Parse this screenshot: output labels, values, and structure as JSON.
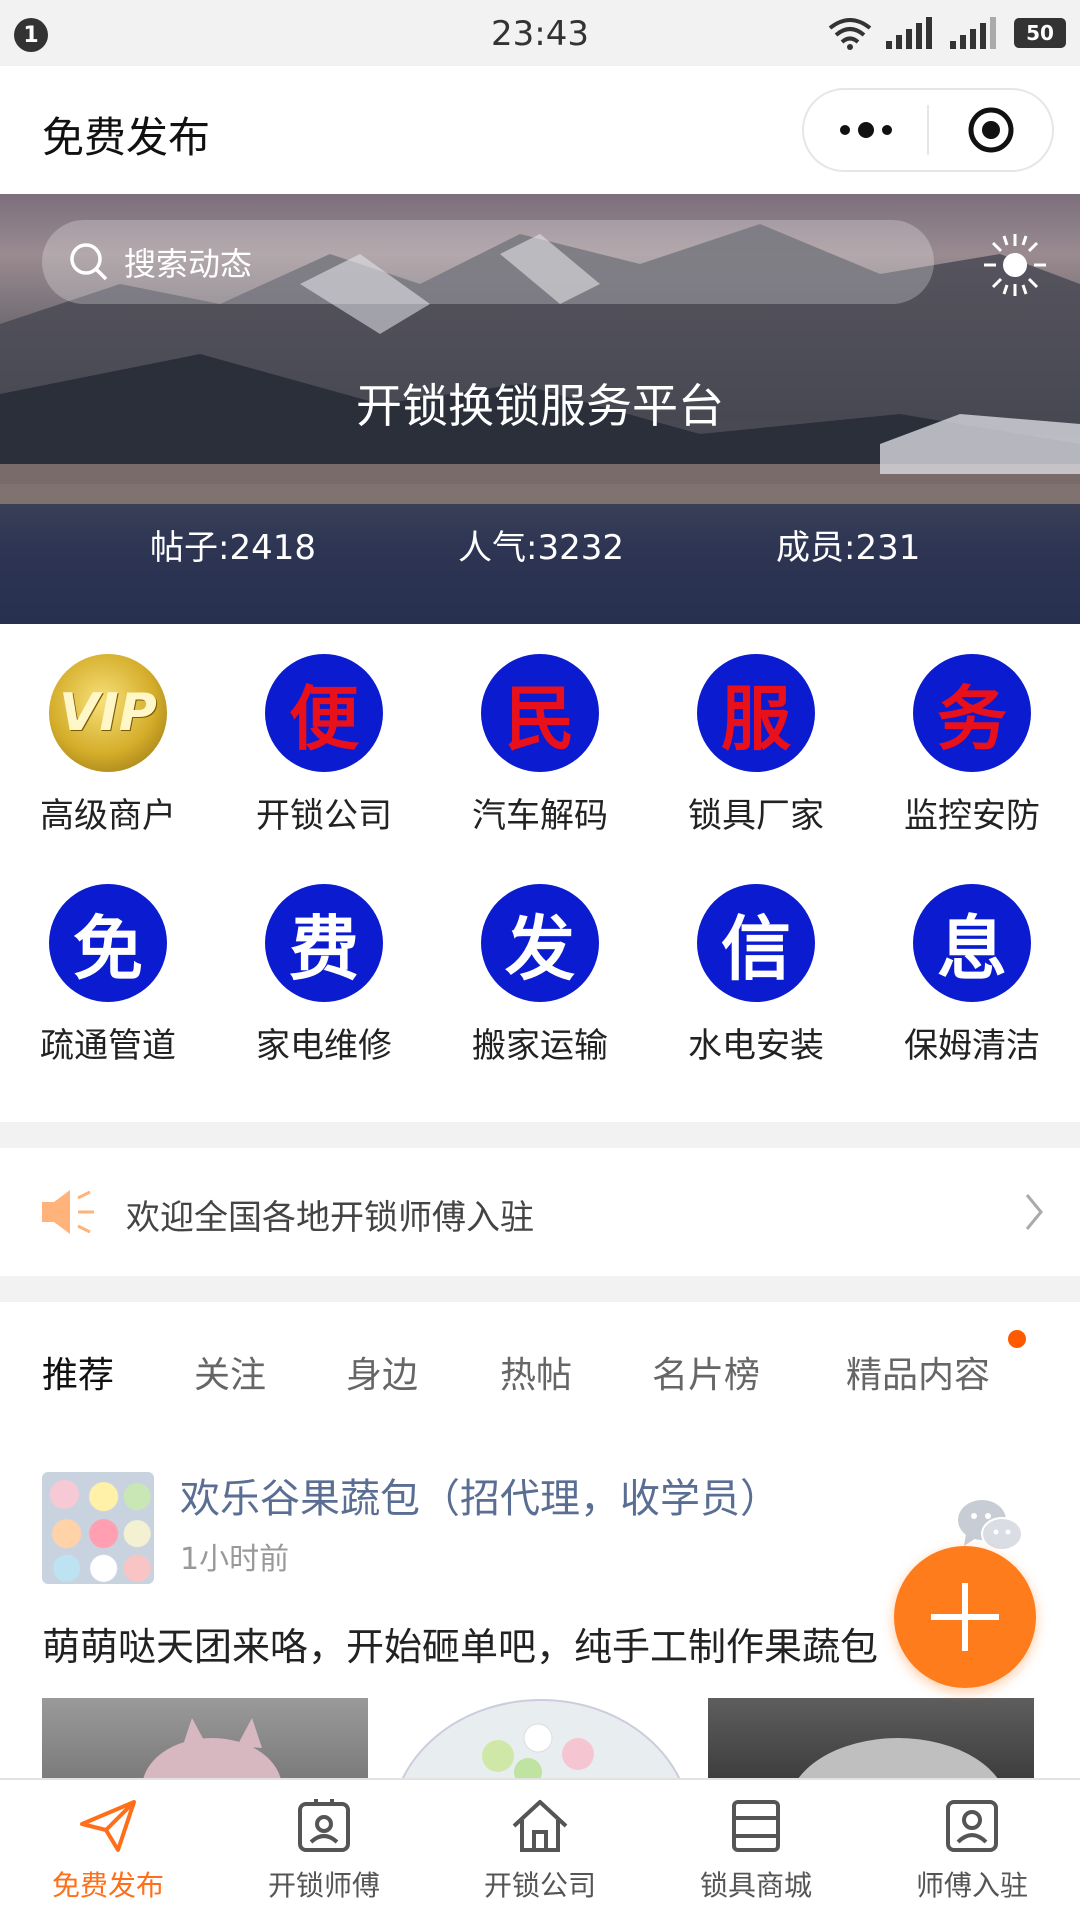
{
  "status_bar": {
    "notification_count": "1",
    "time": "23:43",
    "battery": "50",
    "icons": [
      "wifi-icon",
      "signal-icon",
      "signal-icon",
      "battery-icon"
    ]
  },
  "title_bar": {
    "title": "免费发布",
    "capsule_icons": [
      "more-icon",
      "close-target-icon"
    ]
  },
  "banner": {
    "search_placeholder": "搜索动态",
    "title": "开锁换锁服务平台",
    "stats": {
      "posts": "帖子:2418",
      "popularity": "人气:3232",
      "members": "成员:231"
    }
  },
  "categories": {
    "row1": [
      {
        "icon": "VIP",
        "label": "高级商户"
      },
      {
        "icon": "便",
        "label": "开锁公司"
      },
      {
        "icon": "民",
        "label": "汽车解码"
      },
      {
        "icon": "服",
        "label": "锁具厂家"
      },
      {
        "icon": "务",
        "label": "监控安防"
      }
    ],
    "row2": [
      {
        "icon": "免",
        "label": "疏通管道"
      },
      {
        "icon": "费",
        "label": "家电维修"
      },
      {
        "icon": "发",
        "label": "搬家运输"
      },
      {
        "icon": "信",
        "label": "水电安装"
      },
      {
        "icon": "息",
        "label": "保姆清洁"
      }
    ]
  },
  "notice": {
    "text": "欢迎全国各地开锁师傅入驻"
  },
  "tabs": [
    "推荐",
    "关注",
    "身边",
    "热帖",
    "名片榜",
    "精品内容"
  ],
  "post": {
    "title": "欢乐谷果蔬包（招代理，收学员）",
    "time": "1小时前",
    "body": "萌萌哒天团来咯，开始砸单吧，纯手工制作果蔬包"
  },
  "bottom_nav": [
    {
      "label": "免费发布",
      "icon": "paper-plane-icon",
      "active": true
    },
    {
      "label": "开锁师傅",
      "icon": "id-card-icon",
      "active": false
    },
    {
      "label": "开锁公司",
      "icon": "home-icon",
      "active": false
    },
    {
      "label": "锁具商城",
      "icon": "store-icon",
      "active": false
    },
    {
      "label": "师傅入驻",
      "icon": "profile-icon",
      "active": false
    }
  ],
  "colors": {
    "accent": "#ff6f1a",
    "category_blue": "#0b1bd0",
    "category_red": "#e8101a",
    "post_title": "#5a6e93"
  }
}
